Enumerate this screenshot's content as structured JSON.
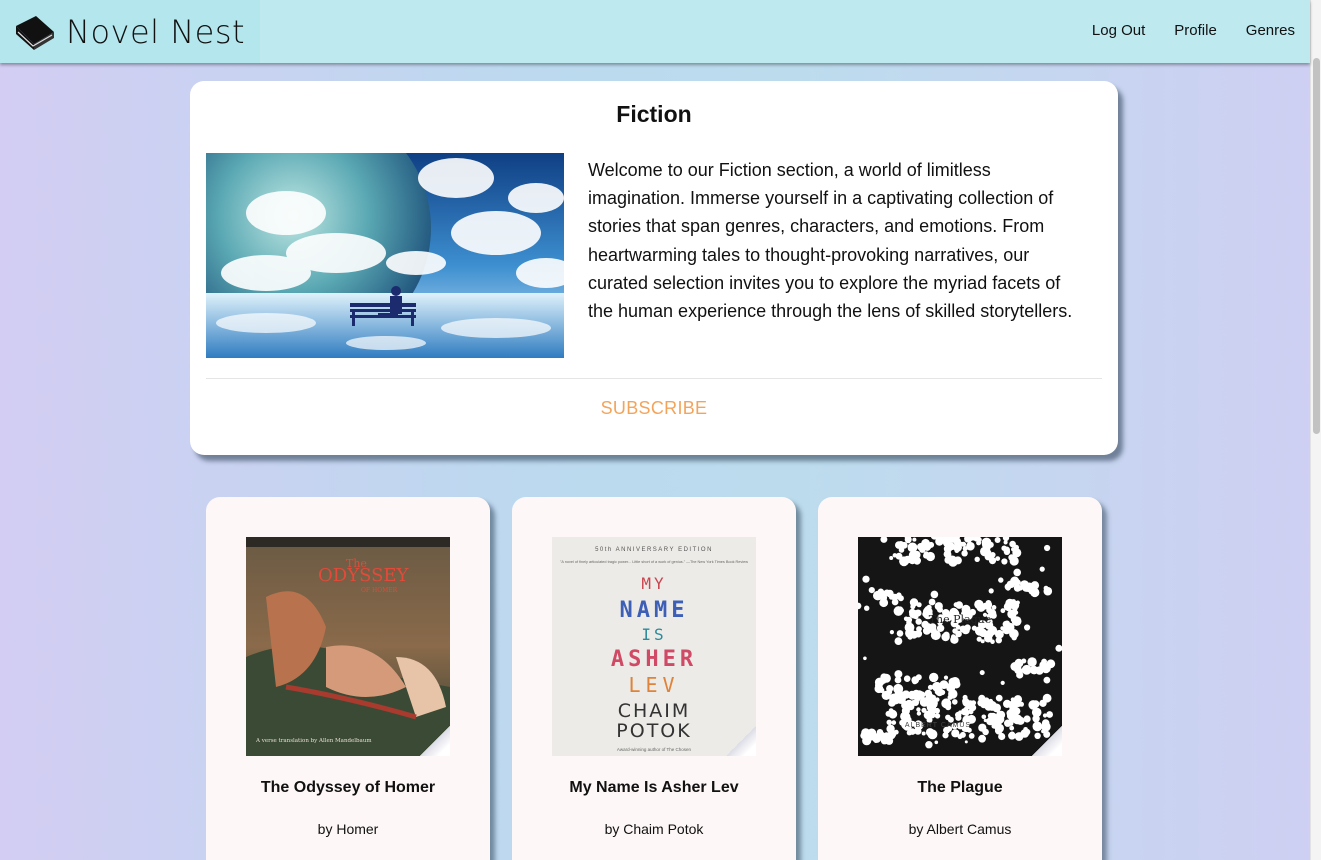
{
  "header": {
    "brand_name": "Novel Nest",
    "brand_icon": "book-icon",
    "nav": [
      {
        "label": "Log Out"
      },
      {
        "label": "Profile"
      },
      {
        "label": "Genres"
      }
    ]
  },
  "genre": {
    "title": "Fiction",
    "description": "Welcome to our Fiction section, a world of limitless imagination. Immerse yourself in a captivating collection of stories that span genres, characters, and emotions. From heartwarming tales to thought-provoking narratives, our curated selection invites you to explore the myriad facets of the human experience through the lens of skilled storytellers.",
    "subscribe_label": "SUBSCRIBE",
    "image": "earth-clouds-bench-illustration"
  },
  "books": [
    {
      "title": "The Odyssey of Homer",
      "author": "by Homer",
      "cover": {
        "line1": "The",
        "line2": "ODYSSEY",
        "line3": "OF HOMER",
        "footer": "A verse translation by Allen Mandelbaum"
      }
    },
    {
      "title": "My Name Is Asher Lev",
      "author": "by Chaim Potok",
      "cover": {
        "top": "50th ANNIVERSARY EDITION",
        "blurb": "\"A novel of finely articulated tragic power... Little short of a work of genius.\" —The New York Times Book Review",
        "w1": "MY",
        "w2": "NAME",
        "w3": "IS",
        "w4": "ASHER",
        "w5": "LEV",
        "author1": "CHAIM",
        "author2": "POTOK",
        "footer": "Award-winning author of The Chosen"
      }
    },
    {
      "title": "The Plague",
      "author": "by Albert Camus",
      "cover": {
        "title": "The Plague",
        "author": "ALBERT CAMUS"
      }
    }
  ],
  "colors": {
    "header_bg": "#bde9ef",
    "subscribe": "#f3a45b",
    "card_bg": "#ffffff",
    "book_card_bg": "#fdf8f7"
  }
}
